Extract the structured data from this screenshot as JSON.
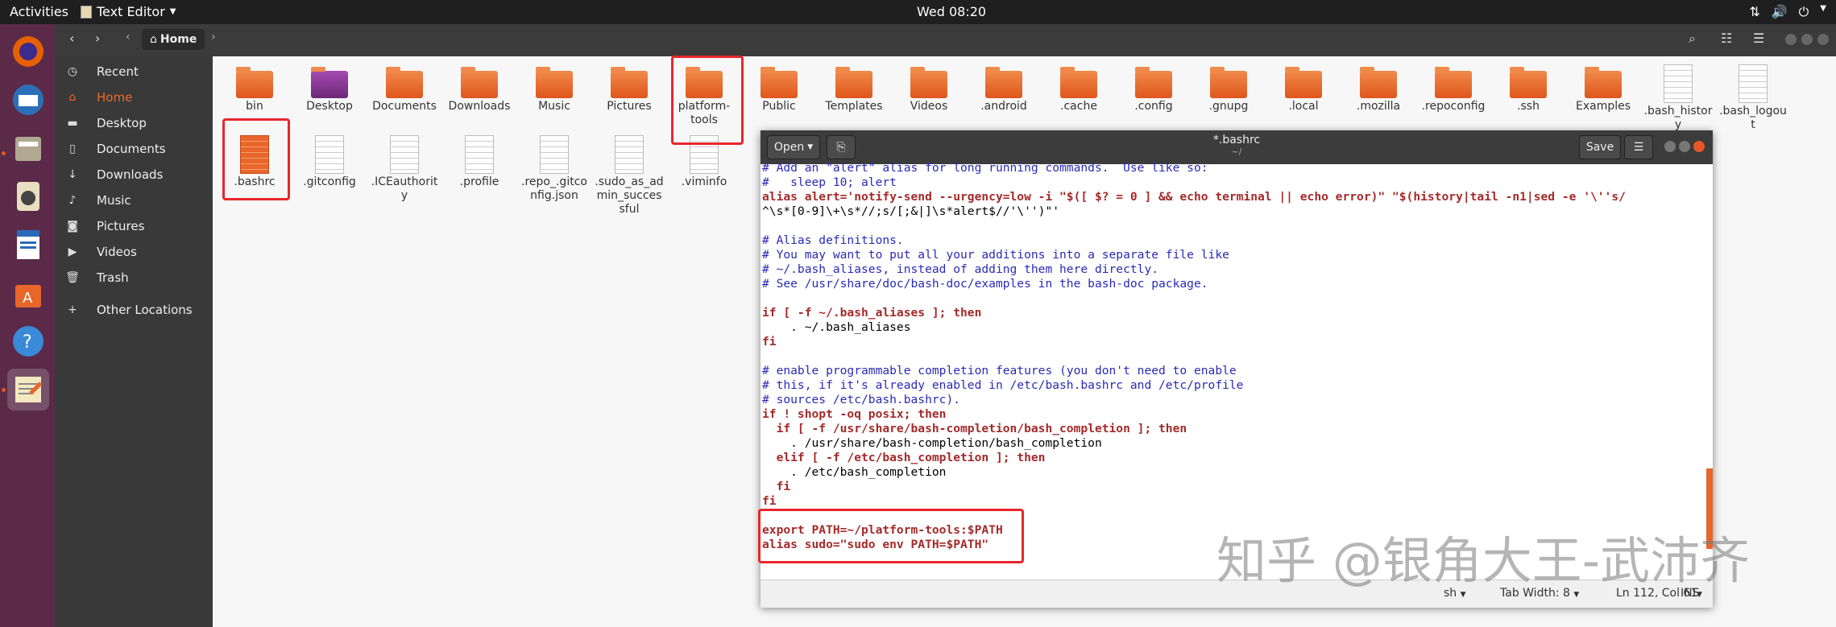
{
  "topbar": {
    "activities": "Activities",
    "app_name": "Text Editor",
    "clock": "Wed 08:20"
  },
  "dock": {
    "apps": [
      "firefox-icon",
      "thunderbird-icon",
      "files-icon",
      "rhythmbox-icon",
      "writer-icon",
      "software-icon",
      "help-icon",
      "text-editor-icon"
    ]
  },
  "nautilus": {
    "location": "Home",
    "sidebar": [
      {
        "icon": "clock-icon",
        "label": "Recent"
      },
      {
        "icon": "home-icon",
        "label": "Home"
      },
      {
        "icon": "folder-icon",
        "label": "Desktop"
      },
      {
        "icon": "document-icon",
        "label": "Documents"
      },
      {
        "icon": "download-icon",
        "label": "Downloads"
      },
      {
        "icon": "music-icon",
        "label": "Music"
      },
      {
        "icon": "camera-icon",
        "label": "Pictures"
      },
      {
        "icon": "video-icon",
        "label": "Videos"
      },
      {
        "icon": "trash-icon",
        "label": "Trash"
      },
      {
        "icon": "plus-icon",
        "label": "Other Locations"
      }
    ],
    "files_row1": [
      {
        "label": "bin",
        "type": "folder"
      },
      {
        "label": "Desktop",
        "type": "folder-desktop"
      },
      {
        "label": "Documents",
        "type": "folder"
      },
      {
        "label": "Downloads",
        "type": "folder"
      },
      {
        "label": "Music",
        "type": "folder"
      },
      {
        "label": "Pictures",
        "type": "folder"
      },
      {
        "label": "platform-tools",
        "type": "folder"
      },
      {
        "label": "Public",
        "type": "folder"
      },
      {
        "label": "Templates",
        "type": "folder"
      },
      {
        "label": "Videos",
        "type": "folder"
      },
      {
        "label": ".android",
        "type": "folder"
      },
      {
        "label": ".cache",
        "type": "folder"
      },
      {
        "label": ".config",
        "type": "folder"
      },
      {
        "label": ".gnupg",
        "type": "folder"
      },
      {
        "label": ".local",
        "type": "folder"
      },
      {
        "label": ".mozilla",
        "type": "folder"
      },
      {
        "label": ".repoconfig",
        "type": "folder"
      },
      {
        "label": ".ssh",
        "type": "folder"
      },
      {
        "label": "Examples",
        "type": "folder"
      },
      {
        "label": ".bash_history",
        "type": "doc"
      },
      {
        "label": ".bash_logout",
        "type": "doc"
      }
    ],
    "files_row2": [
      {
        "label": ".bashrc",
        "type": "doc-orange"
      },
      {
        "label": ".gitconfig",
        "type": "doc"
      },
      {
        "label": ".ICEauthority",
        "type": "doc"
      },
      {
        "label": ".profile",
        "type": "doc"
      },
      {
        "label": ".repo_.gitconfig.json",
        "type": "doc"
      },
      {
        "label": ".sudo_as_admin_successful",
        "type": "doc"
      },
      {
        "label": ".viminfo",
        "type": "doc"
      }
    ]
  },
  "gedit": {
    "open_label": "Open",
    "title": "*.bashrc",
    "subtitle": "~/",
    "save_label": "Save",
    "code_lines": [
      "# Add an \"alert\" alias for long running commands.  Use like so:",
      "#   sleep 10; alert",
      "alias alert='notify-send --urgency=low -i \"$([ $? = 0 ] && echo terminal || echo error)\" \"$(history|tail -n1|sed -e '\\''s/",
      "^\\s*[0-9]\\+\\s*//;s/[;&|]\\s*alert$//'\\'')\"'",
      "",
      "# Alias definitions.",
      "# You may want to put all your additions into a separate file like",
      "# ~/.bash_aliases, instead of adding them here directly.",
      "# See /usr/share/doc/bash-doc/examples in the bash-doc package.",
      "",
      "if [ -f ~/.bash_aliases ]; then",
      "    . ~/.bash_aliases",
      "fi",
      "",
      "# enable programmable completion features (you don't need to enable",
      "# this, if it's already enabled in /etc/bash.bashrc and /etc/profile",
      "# sources /etc/bash.bashrc).",
      "if ! shopt -oq posix; then",
      "  if [ -f /usr/share/bash-completion/bash_completion ]; then",
      "    . /usr/share/bash-completion/bash_completion",
      "  elif [ -f /etc/bash_completion ]; then",
      "    . /etc/bash_completion",
      "  fi",
      "fi",
      "",
      "export PATH=~/platform-tools:$PATH",
      "alias sudo=\"sudo env PATH=$PATH\""
    ],
    "status": {
      "lang": "sh",
      "tab_width": "Tab Width: 8",
      "position": "Ln 112, Col 61",
      "mode": "INS"
    }
  },
  "watermark": "知乎 @银角大王-武沛齐"
}
